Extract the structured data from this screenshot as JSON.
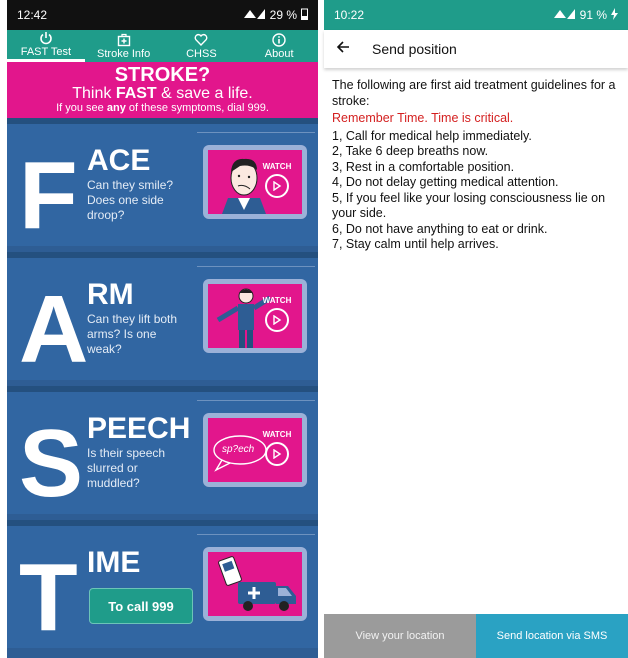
{
  "left": {
    "status": {
      "time": "12:42",
      "battery": "29 %"
    },
    "nav": [
      {
        "label": "FAST Test",
        "icon": "power-icon"
      },
      {
        "label": "Stroke Info",
        "icon": "first-aid-icon"
      },
      {
        "label": "CHSS",
        "icon": "heart-icon"
      },
      {
        "label": "About",
        "icon": "info-icon"
      }
    ],
    "banner": {
      "title": "STROKE?",
      "sub_pre": "Think ",
      "sub_bold": "FAST",
      "sub_post": " & save a life.",
      "note_pre": "If you see ",
      "note_bold": "any",
      "note_post": " of these symptoms, dial 999."
    },
    "cards": [
      {
        "letter": "F",
        "word": "ACE",
        "desc": "Can they smile? Does one side droop?",
        "watch": "WATCH"
      },
      {
        "letter": "A",
        "word": "RM",
        "desc": "Can they lift both arms? Is one weak?",
        "watch": "WATCH"
      },
      {
        "letter": "S",
        "word": "PEECH",
        "desc": "Is their speech slurred or muddled?",
        "watch": "WATCH",
        "bubble": "sp?ech"
      },
      {
        "letter": "T",
        "word": "IME",
        "button": "To call 999"
      }
    ]
  },
  "right": {
    "status": {
      "time": "10:22",
      "battery": "91 %"
    },
    "title": "Send position",
    "intro": "The following are first aid treatment guidelines for a stroke:",
    "warning": "Remember Time. Time is critical.",
    "steps": [
      "1, Call for medical help immediately.",
      " 2, Take 6 deep breaths now.",
      " 3, Rest in a comfortable position.",
      " 4, Do not delay getting medical attention.",
      " 5, If you feel like your losing consciousness lie on your side.",
      " 6, Do not have anything to eat or drink.",
      " 7, Stay calm until help arrives."
    ],
    "buttons": {
      "view": "View your location",
      "send": "Send location via SMS"
    }
  }
}
